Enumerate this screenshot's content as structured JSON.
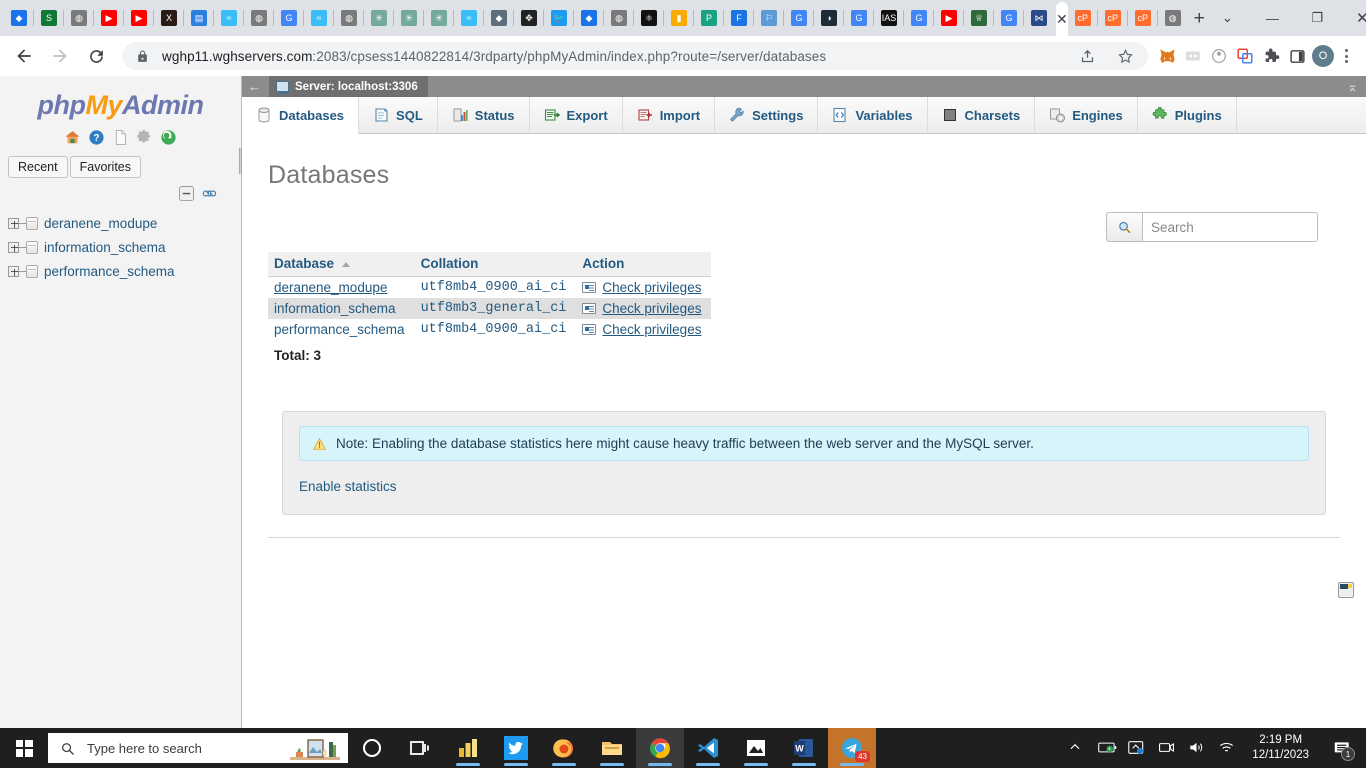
{
  "browser": {
    "tabs": [
      {
        "name": "tab-favicon-cpanel-blue",
        "color": "#1a73e8",
        "glyph": "◆"
      },
      {
        "name": "tab-favicon-shopify",
        "color": "#0f7a36",
        "glyph": "S"
      },
      {
        "name": "tab-favicon-globe-grey",
        "color": "#7a7a7a",
        "glyph": "◍"
      },
      {
        "name": "tab-favicon-youtube",
        "color": "#ff0000",
        "glyph": "▶"
      },
      {
        "name": "tab-favicon-youtube-2",
        "color": "#ff0000",
        "glyph": "▶"
      },
      {
        "name": "tab-favicon-x-twitter",
        "color": "#2b1a14",
        "glyph": "X"
      },
      {
        "name": "tab-favicon-document-blue",
        "color": "#2b7fe0",
        "glyph": "▤"
      },
      {
        "name": "tab-favicon-tailwind",
        "color": "#38bdf8",
        "glyph": "≈"
      },
      {
        "name": "tab-favicon-globe-grey-2",
        "color": "#7a7a7a",
        "glyph": "◍"
      },
      {
        "name": "tab-favicon-google",
        "color": "#4285f4",
        "glyph": "G"
      },
      {
        "name": "tab-favicon-tailwind-2",
        "color": "#38bdf8",
        "glyph": "≈"
      },
      {
        "name": "tab-favicon-globe-grey-3",
        "color": "#7a7a7a",
        "glyph": "◍"
      },
      {
        "name": "tab-favicon-chatgpt",
        "color": "#74aa9c",
        "glyph": "✳"
      },
      {
        "name": "tab-favicon-chatgpt-2",
        "color": "#74aa9c",
        "glyph": "✳"
      },
      {
        "name": "tab-favicon-chatgpt-3",
        "color": "#74aa9c",
        "glyph": "✳"
      },
      {
        "name": "tab-favicon-tailwind-3",
        "color": "#38bdf8",
        "glyph": "≈"
      },
      {
        "name": "tab-favicon-layers-dark",
        "color": "#5d6d7e",
        "glyph": "◆"
      },
      {
        "name": "tab-favicon-target",
        "color": "#222222",
        "glyph": "✥"
      },
      {
        "name": "tab-favicon-twitter",
        "color": "#1d9bf0",
        "glyph": "🐦"
      },
      {
        "name": "tab-favicon-cpanel-blue-2",
        "color": "#1a73e8",
        "glyph": "◆"
      },
      {
        "name": "tab-favicon-globe-grey-4",
        "color": "#7a7a7a",
        "glyph": "◍"
      },
      {
        "name": "tab-favicon-network-black",
        "color": "#111111",
        "glyph": "⚛"
      },
      {
        "name": "tab-favicon-google-analytics",
        "color": "#f9ab00",
        "glyph": "▮"
      },
      {
        "name": "tab-favicon-paperform",
        "color": "#19a384",
        "glyph": "P"
      },
      {
        "name": "tab-favicon-facebook-blue",
        "color": "#1b74e4",
        "glyph": "F"
      },
      {
        "name": "tab-favicon-flag-outline",
        "color": "#5b9bd5",
        "glyph": "⚐"
      },
      {
        "name": "tab-favicon-google-2",
        "color": "#4285f4",
        "glyph": "G"
      },
      {
        "name": "tab-favicon-dark-swirl",
        "color": "#1d2b36",
        "glyph": "◑"
      },
      {
        "name": "tab-favicon-google-3",
        "color": "#4285f4",
        "glyph": "G"
      },
      {
        "name": "tab-favicon-ias-plus",
        "color": "#111111",
        "glyph": "IAS"
      },
      {
        "name": "tab-favicon-google-4",
        "color": "#4285f4",
        "glyph": "G"
      },
      {
        "name": "tab-favicon-youtube-3",
        "color": "#ff0000",
        "glyph": "▶"
      },
      {
        "name": "tab-favicon-emblem-green",
        "color": "#2f6b3a",
        "glyph": "♕"
      },
      {
        "name": "tab-favicon-google-5",
        "color": "#4285f4",
        "glyph": "G"
      },
      {
        "name": "tab-favicon-phpmyadmin",
        "color": "#2b4a8b",
        "glyph": "⋈"
      }
    ],
    "active_tab_close_label": "✕",
    "tabs_after": [
      {
        "name": "tab-favicon-cpanel-orange",
        "color": "#ff6c2c",
        "glyph": "cP"
      },
      {
        "name": "tab-favicon-cpanel-orange-2",
        "color": "#ff6c2c",
        "glyph": "cP"
      },
      {
        "name": "tab-favicon-cpanel-orange-3",
        "color": "#ff6c2c",
        "glyph": "cP"
      },
      {
        "name": "tab-favicon-globe-grey-5",
        "color": "#7a7a7a",
        "glyph": "◍"
      }
    ],
    "new_tab_label": "+",
    "window_controls": {
      "tablist": "⌄",
      "minimize": "—",
      "maximize": "❐",
      "close": "✕"
    },
    "nav": {
      "back": "←",
      "forward": "→",
      "reload": "⟳"
    },
    "address": {
      "url_bold": "wghp11.wghservers.com",
      "url_rest": ":2083/cpsess1440822814/3rdparty/phpMyAdmin/index.php?route=/server/databases",
      "full_url": "wghp11.wghservers.com:2083/cpsess1440822814/3rdparty/phpMyAdmin/index.php?route=/server/databases"
    },
    "toolbar_icons": [
      {
        "name": "share-icon",
        "glyph": "↗"
      },
      {
        "name": "bookmark-star-icon",
        "glyph": "☆"
      },
      {
        "name": "metamask-extension-icon",
        "glyph": "🦊"
      },
      {
        "name": "extension-grey-icon",
        "glyph": "▦"
      },
      {
        "name": "extension-circle-icon",
        "glyph": "◎"
      },
      {
        "name": "tab-copy-extension-icon",
        "glyph": "❐"
      },
      {
        "name": "extensions-puzzle-icon",
        "glyph": "🧩"
      },
      {
        "name": "side-panel-icon",
        "glyph": "▣"
      }
    ],
    "profile_initial": "O",
    "menu_label": "⋮"
  },
  "phpmyadmin": {
    "logo": {
      "php": "php",
      "my": "My",
      "admin": "Admin"
    },
    "sidebar_icons": [
      {
        "name": "home-icon"
      },
      {
        "name": "help-icon"
      },
      {
        "name": "documentation-icon"
      },
      {
        "name": "settings-gear-icon"
      },
      {
        "name": "reload-navigation-icon"
      }
    ],
    "quick_buttons": [
      {
        "name": "recent-button",
        "label": "Recent"
      },
      {
        "name": "favorites-button",
        "label": "Favorites"
      }
    ],
    "nav_controls": [
      {
        "name": "collapse-all-icon"
      },
      {
        "name": "link-with-main-panel-icon"
      }
    ],
    "databases_tree": [
      {
        "name": "deranene_modupe"
      },
      {
        "name": "information_schema"
      },
      {
        "name": "performance_schema"
      }
    ],
    "server_bar": {
      "back_arrow": "←",
      "server_label": "Server: localhost:3306",
      "collapse_label": "⌅"
    },
    "tabs": [
      {
        "label": "Databases",
        "icon": "database-icon",
        "active": true
      },
      {
        "label": "SQL",
        "icon": "sql-scroll-icon",
        "active": false
      },
      {
        "label": "Status",
        "icon": "status-chart-icon",
        "active": false
      },
      {
        "label": "Export",
        "icon": "export-icon",
        "active": false
      },
      {
        "label": "Import",
        "icon": "import-icon",
        "active": false
      },
      {
        "label": "Settings",
        "icon": "wrench-icon",
        "active": false
      },
      {
        "label": "Variables",
        "icon": "variables-code-icon",
        "active": false
      },
      {
        "label": "Charsets",
        "icon": "charsets-lines-icon",
        "active": false
      },
      {
        "label": "Engines",
        "icon": "engines-gear-icon",
        "active": false
      },
      {
        "label": "Plugins",
        "icon": "plugins-puzzle-icon",
        "active": false
      }
    ],
    "page_title": "Databases",
    "search": {
      "placeholder": "Search",
      "value": "",
      "icon": "search-magnifier-icon"
    },
    "table": {
      "headers": [
        "Database",
        "Collation",
        "Action"
      ],
      "sort_column": "Database",
      "sort_direction": "asc",
      "rows": [
        {
          "database": "deranene_modupe",
          "collation": "utf8mb4_0900_ai_ci",
          "action": "Check privileges",
          "highlight": false,
          "hovered": true
        },
        {
          "database": "information_schema",
          "collation": "utf8mb3_general_ci",
          "action": "Check privileges",
          "highlight": true,
          "hovered": false
        },
        {
          "database": "performance_schema",
          "collation": "utf8mb4_0900_ai_ci",
          "action": "Check privileges",
          "highlight": false,
          "hovered": false
        }
      ],
      "total_label": "Total: 3"
    },
    "note": {
      "icon": "warning-triangle-icon",
      "text": "Note: Enabling the database statistics here might cause heavy traffic between the web server and the MySQL server."
    },
    "enable_statistics_label": "Enable statistics",
    "floating_console_button": "console-toggle-icon"
  },
  "taskbar": {
    "start_label": "start-button",
    "search_placeholder": "Type here to search",
    "search_icon": "magnifier-icon",
    "buttons": [
      {
        "name": "taskview-cortana-icon",
        "glyph": "◯",
        "highlight": false
      },
      {
        "name": "task-view-icon",
        "glyph": "⊟",
        "highlight": false
      },
      {
        "name": "power-bi-icon",
        "glyph": "▯",
        "highlight": false
      },
      {
        "name": "twitter-icon",
        "glyph": "🐦",
        "highlight": false
      },
      {
        "name": "firefox-icon",
        "glyph": "🦊",
        "highlight": false
      },
      {
        "name": "file-explorer-icon",
        "glyph": "🗂",
        "highlight": false
      },
      {
        "name": "google-chrome-icon",
        "glyph": "◉",
        "highlight": true
      },
      {
        "name": "vs-code-icon",
        "glyph": "✕",
        "highlight": false
      },
      {
        "name": "photos-icon",
        "glyph": "▲",
        "highlight": false
      },
      {
        "name": "microsoft-word-icon",
        "glyph": "W",
        "highlight": false
      },
      {
        "name": "telegram-icon",
        "glyph": "➤",
        "highlight": false,
        "badge": "43"
      }
    ],
    "tray": [
      {
        "name": "show-hidden-icons-chevron",
        "glyph": "︿"
      },
      {
        "name": "battery-saver-icon",
        "glyph": "▭"
      },
      {
        "name": "onedrive-sync-icon",
        "glyph": "☁"
      },
      {
        "name": "camera-icon",
        "glyph": "▢"
      },
      {
        "name": "volume-icon",
        "glyph": "🔊"
      },
      {
        "name": "wifi-icon",
        "glyph": "◞"
      }
    ],
    "time": "2:19 PM",
    "date": "12/11/2023",
    "notification_count": "1"
  }
}
